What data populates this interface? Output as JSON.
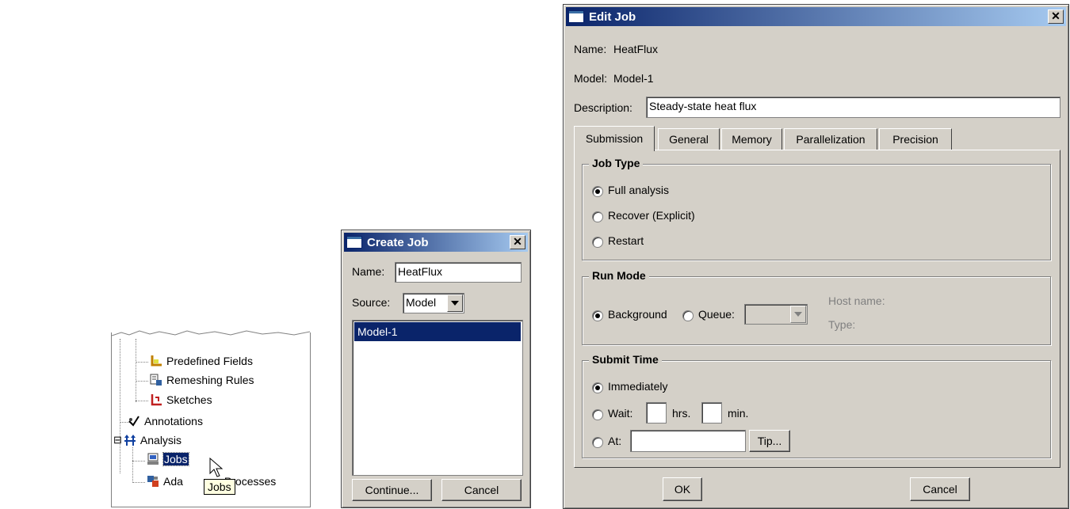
{
  "tree": {
    "items": [
      {
        "label": "Predefined Fields",
        "icon": "predefined-fields-icon"
      },
      {
        "label": "Remeshing Rules",
        "icon": "remeshing-rules-icon"
      },
      {
        "label": "Sketches",
        "icon": "sketches-icon"
      },
      {
        "label": "Annotations",
        "icon": "annotations-icon"
      },
      {
        "label": "Analysis",
        "icon": "analysis-icon",
        "expander": "⊟"
      },
      {
        "label": "Jobs",
        "icon": "jobs-icon",
        "selected": true
      },
      {
        "label": "Ada",
        "label_tail": "Processes",
        "icon": "adaptivity-processes-icon"
      }
    ],
    "tooltip": "Jobs"
  },
  "create_job": {
    "title": "Create Job",
    "close": "✕",
    "name_label": "Name:",
    "name_value": "HeatFlux",
    "source_label": "Source:",
    "source_value": "Model",
    "models": [
      "Model-1"
    ],
    "continue_label": "Continue...",
    "cancel_label": "Cancel"
  },
  "edit_job": {
    "title": "Edit Job",
    "close": "✕",
    "name_label": "Name:",
    "name_value": "HeatFlux",
    "model_label": "Model:",
    "model_value": "Model-1",
    "description_label": "Description:",
    "description_value": "Steady-state heat flux",
    "tabs": [
      "Submission",
      "General",
      "Memory",
      "Parallelization",
      "Precision"
    ],
    "active_tab": "Submission",
    "job_type": {
      "title": "Job Type",
      "options": [
        "Full analysis",
        "Recover (Explicit)",
        "Restart"
      ],
      "selected": "Full analysis"
    },
    "run_mode": {
      "title": "Run Mode",
      "background_label": "Background",
      "queue_label": "Queue:",
      "selected": "Background",
      "host_name_label": "Host name:",
      "type_label": "Type:"
    },
    "submit_time": {
      "title": "Submit Time",
      "immediately_label": "Immediately",
      "wait_label": "Wait:",
      "hrs_label": "hrs.",
      "min_label": "min.",
      "at_label": "At:",
      "tip_label": "Tip...",
      "selected": "Immediately"
    },
    "ok_label": "OK",
    "cancel_label": "Cancel"
  },
  "colors": {
    "dialog_bg": "#d4d0c8",
    "title_start": "#0a246a",
    "title_end": "#a6caf0",
    "selection": "#0a246a",
    "tooltip_bg": "#ffffe1"
  }
}
